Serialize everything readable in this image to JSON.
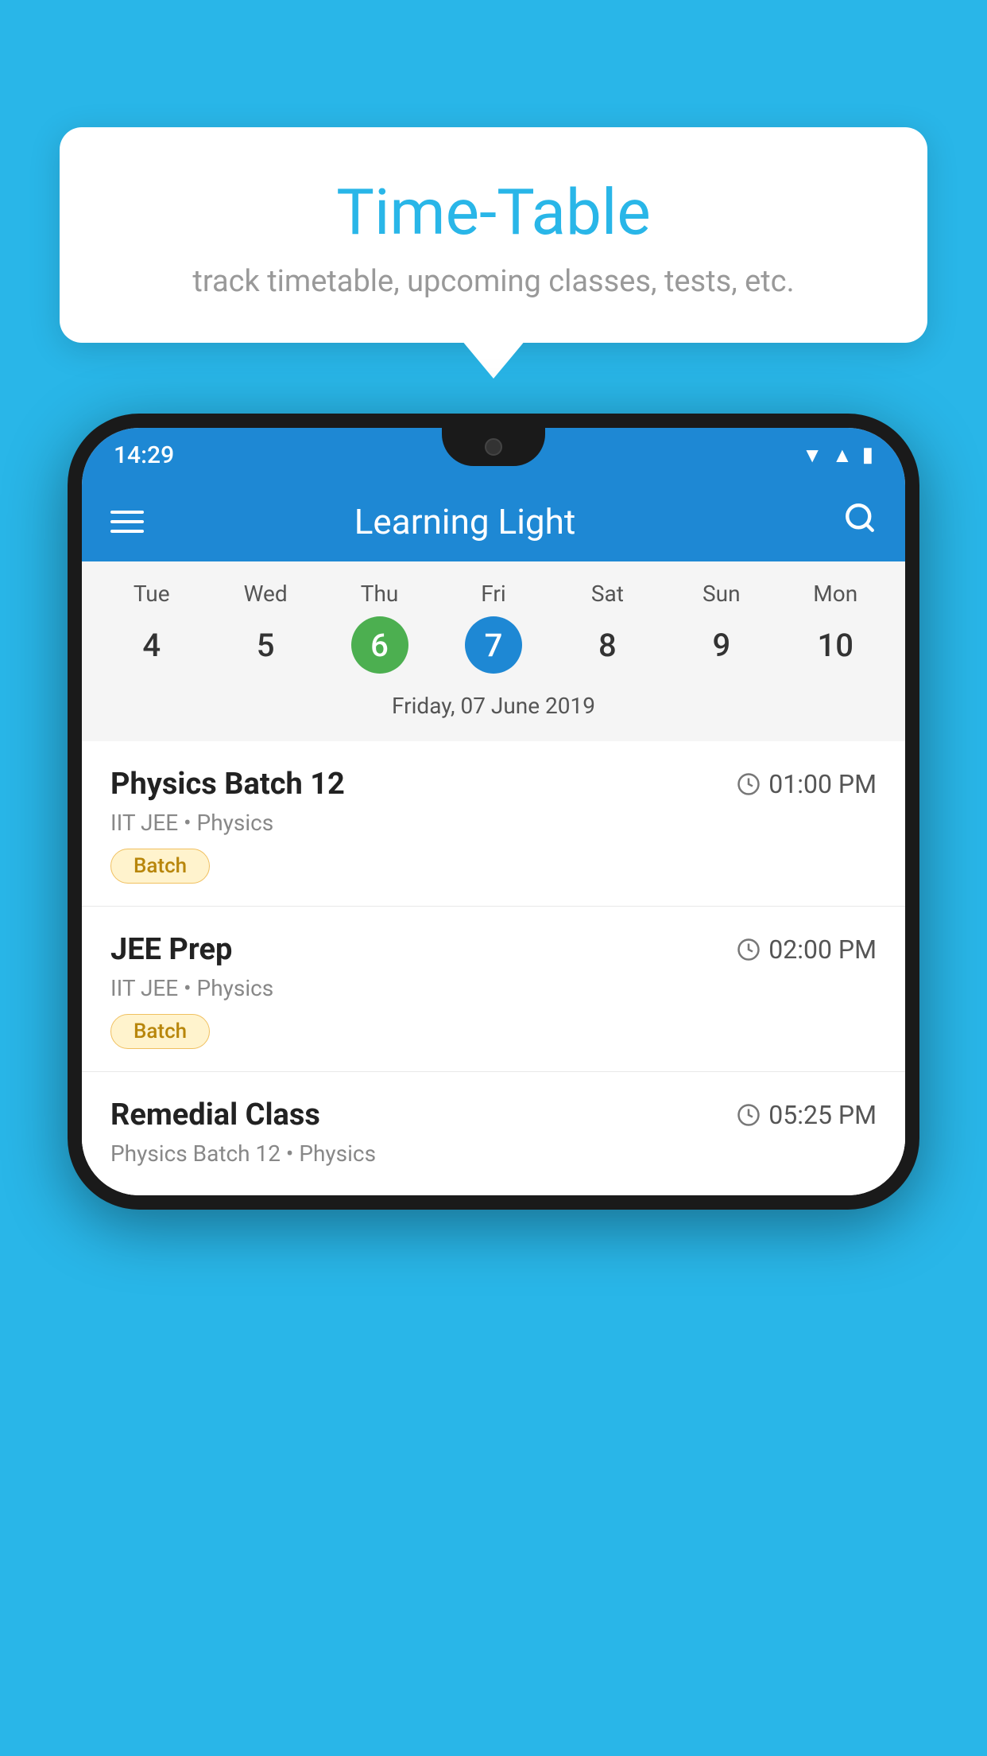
{
  "background_color": "#29B6E8",
  "tooltip": {
    "title": "Time-Table",
    "subtitle": "track timetable, upcoming classes, tests, etc."
  },
  "phone": {
    "status_bar": {
      "time": "14:29"
    },
    "app_bar": {
      "title": "Learning Light"
    },
    "calendar": {
      "days": [
        {
          "name": "Tue",
          "num": "4",
          "state": "normal"
        },
        {
          "name": "Wed",
          "num": "5",
          "state": "normal"
        },
        {
          "name": "Thu",
          "num": "6",
          "state": "today"
        },
        {
          "name": "Fri",
          "num": "7",
          "state": "selected"
        },
        {
          "name": "Sat",
          "num": "8",
          "state": "normal"
        },
        {
          "name": "Sun",
          "num": "9",
          "state": "normal"
        },
        {
          "name": "Mon",
          "num": "10",
          "state": "normal"
        }
      ],
      "selected_date_label": "Friday, 07 June 2019"
    },
    "schedule": [
      {
        "title": "Physics Batch 12",
        "time": "01:00 PM",
        "subtitle": "IIT JEE • Physics",
        "badge": "Batch"
      },
      {
        "title": "JEE Prep",
        "time": "02:00 PM",
        "subtitle": "IIT JEE • Physics",
        "badge": "Batch"
      },
      {
        "title": "Remedial Class",
        "time": "05:25 PM",
        "subtitle": "Physics Batch 12 • Physics",
        "badge": null
      }
    ]
  }
}
